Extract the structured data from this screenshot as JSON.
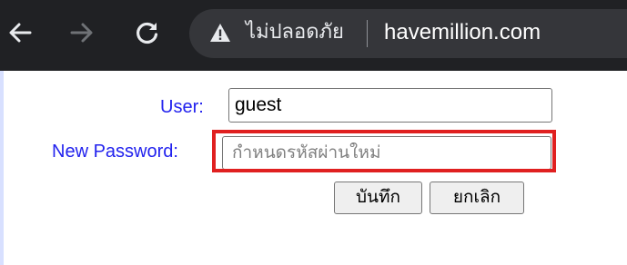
{
  "browser": {
    "security_label": "ไม่ปลอดภัย",
    "url": "havemillion.com",
    "icons": {
      "back": "arrow-left-icon",
      "forward": "arrow-right-icon",
      "reload": "reload-icon",
      "warning": "warning-triangle-icon"
    }
  },
  "form": {
    "user_label": "User:",
    "user_value": "guest",
    "password_label": "New Password:",
    "password_placeholder": "กำหนดรหัสผ่านใหม่",
    "save_label": "บันทึก",
    "cancel_label": "ยกเลิก"
  },
  "colors": {
    "toolbar_bg": "#202124",
    "label": "#2222ee",
    "highlight": "#e02020"
  }
}
